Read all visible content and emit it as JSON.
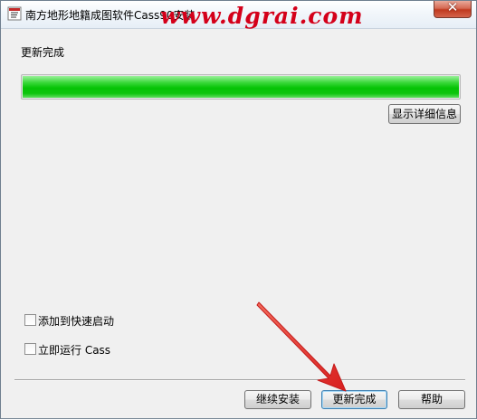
{
  "window": {
    "title": "南方地形地籍成图软件Cass90安装",
    "close_symbol": "✕"
  },
  "watermark": {
    "text": "www.dgrai.com"
  },
  "status": {
    "label": "更新完成",
    "progress": 1.0
  },
  "buttons": {
    "details_label": "显示详细信息",
    "continue_label": "继续安装",
    "finish_label": "更新完成",
    "help_label": "帮助"
  },
  "options": [
    {
      "label": "添加到快速启动",
      "checked": false
    },
    {
      "label": "立即运行 Cass",
      "checked": false
    }
  ],
  "colors": {
    "progress_green": "#05c305",
    "watermark_red": "#d4001a",
    "arrow_red": "#e8322a"
  },
  "icons": {
    "app": "app-icon",
    "close": "close-icon",
    "annotation": "red-arrow-icon"
  }
}
